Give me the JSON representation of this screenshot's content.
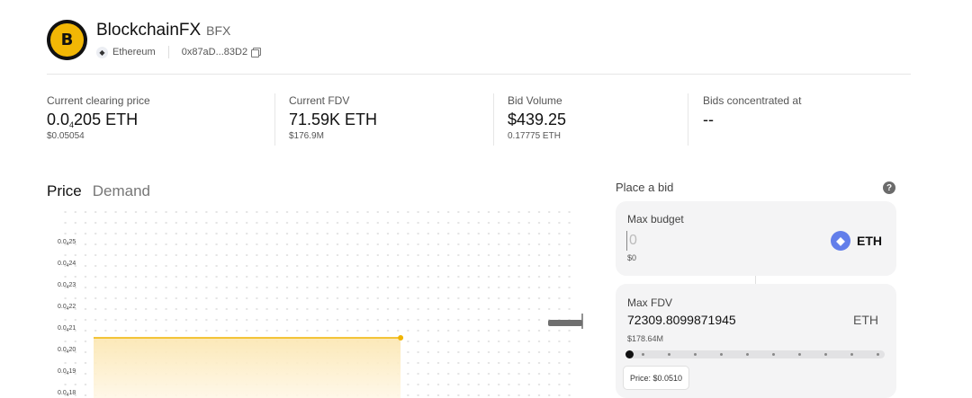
{
  "token": {
    "name": "BlockchainFX",
    "symbol": "BFX",
    "logo_letter": "B",
    "chain": "Ethereum",
    "address": "0x87aD...83D2"
  },
  "stats": [
    {
      "label": "Current clearing price",
      "value_prefix": "0.0",
      "value_sub": "4",
      "value_suffix": "205 ETH",
      "sub": "$0.05054"
    },
    {
      "label": "Current FDV",
      "value": "71.59K ETH",
      "sub": "$176.9M"
    },
    {
      "label": "Bid Volume",
      "value": "$439.25",
      "sub": "0.17775 ETH"
    },
    {
      "label": "Bids concentrated at",
      "value": "--",
      "sub": ""
    }
  ],
  "tabs": [
    {
      "label": "Price",
      "active": true
    },
    {
      "label": "Demand",
      "active": false
    }
  ],
  "chart_data": {
    "type": "area",
    "yticks": [
      {
        "pre": "0.0",
        "sub": "4",
        "post": "25"
      },
      {
        "pre": "0.0",
        "sub": "4",
        "post": "24"
      },
      {
        "pre": "0.0",
        "sub": "4",
        "post": "23"
      },
      {
        "pre": "0.0",
        "sub": "4",
        "post": "22"
      },
      {
        "pre": "0.0",
        "sub": "4",
        "post": "21"
      },
      {
        "pre": "0.0",
        "sub": "4",
        "post": "20"
      },
      {
        "pre": "0.0",
        "sub": "4",
        "post": "19"
      },
      {
        "pre": "0.0",
        "sub": "4",
        "post": "18"
      }
    ],
    "ytick_values": [
      2.5e-05,
      2.4e-05,
      2.3e-05,
      2.2e-05,
      2.1e-05,
      2e-05,
      1.9e-05,
      1.8e-05
    ],
    "series": [
      {
        "values": [
          2.05e-05,
          2.05e-05
        ]
      }
    ],
    "x_fraction": [
      0.0,
      0.64
    ],
    "grid": true,
    "colors": {
      "line": "#f0b400",
      "fill_top": "#fbe6b0",
      "fill_bottom": "#fff7e6",
      "grid": "#d4d4d4"
    }
  },
  "bid": {
    "title": "Place a bid",
    "help": "?",
    "max_budget_label": "Max budget",
    "budget_placeholder": "0",
    "budget_usd": "$0",
    "currency": "ETH",
    "max_fdv_label": "Max FDV",
    "max_fdv_value": "72309.8099871945",
    "max_fdv_unit": "ETH",
    "max_fdv_usd": "$178.64M",
    "slider_value": 0,
    "price_tooltip": "Price: $0.0510"
  }
}
